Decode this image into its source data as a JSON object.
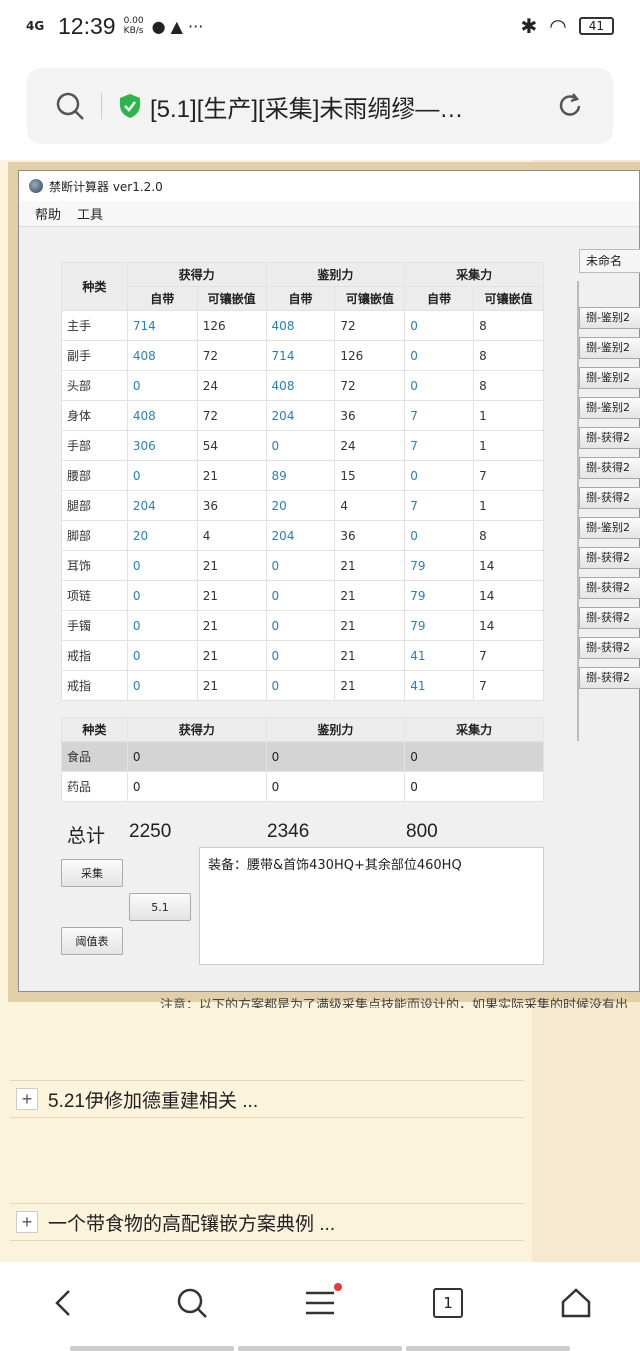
{
  "status": {
    "network": "4G",
    "time": "12:39",
    "speed_top": "0.00",
    "speed_bottom": "KB/s",
    "more": "···",
    "battery": "41"
  },
  "browser": {
    "title": "[5.1][生产][采集]未雨绸缪—…",
    "tab_count": "1"
  },
  "app": {
    "title": "禁断计算器 ver1.2.0",
    "menu": [
      "帮助",
      "工具"
    ],
    "table": {
      "col_type": "种类",
      "groups": [
        "获得力",
        "鉴别力",
        "采集力"
      ],
      "sub": [
        "自带",
        "可镶嵌值"
      ],
      "rows": [
        {
          "name": "主手",
          "v": [
            "714",
            "126",
            "408",
            "72",
            "0",
            "8"
          ]
        },
        {
          "name": "副手",
          "v": [
            "408",
            "72",
            "714",
            "126",
            "0",
            "8"
          ]
        },
        {
          "name": "头部",
          "v": [
            "0",
            "24",
            "408",
            "72",
            "0",
            "8"
          ]
        },
        {
          "name": "身体",
          "v": [
            "408",
            "72",
            "204",
            "36",
            "7",
            "1"
          ]
        },
        {
          "name": "手部",
          "v": [
            "306",
            "54",
            "0",
            "24",
            "7",
            "1"
          ]
        },
        {
          "name": "腰部",
          "v": [
            "0",
            "21",
            "89",
            "15",
            "0",
            "7"
          ]
        },
        {
          "name": "腿部",
          "v": [
            "204",
            "36",
            "20",
            "4",
            "7",
            "1"
          ]
        },
        {
          "name": "脚部",
          "v": [
            "20",
            "4",
            "204",
            "36",
            "0",
            "8"
          ]
        },
        {
          "name": "耳饰",
          "v": [
            "0",
            "21",
            "0",
            "21",
            "79",
            "14"
          ]
        },
        {
          "name": "项链",
          "v": [
            "0",
            "21",
            "0",
            "21",
            "79",
            "14"
          ]
        },
        {
          "name": "手镯",
          "v": [
            "0",
            "21",
            "0",
            "21",
            "79",
            "14"
          ]
        },
        {
          "name": "戒指",
          "v": [
            "0",
            "21",
            "0",
            "21",
            "41",
            "7"
          ]
        },
        {
          "name": "戒指",
          "v": [
            "0",
            "21",
            "0",
            "21",
            "41",
            "7"
          ]
        }
      ]
    },
    "food_table": {
      "rows": [
        {
          "name": "食品",
          "v": [
            "0",
            "0",
            "0"
          ]
        },
        {
          "name": "药品",
          "v": [
            "0",
            "0",
            "0"
          ]
        }
      ]
    },
    "totals": {
      "label": "总计",
      "gain": "2250",
      "ident": "2346",
      "gather": "800"
    },
    "buttons": {
      "collect": "采集",
      "version": "5.1",
      "threshold": "阈值表"
    },
    "notes": "装备：腰带&首饰430HQ+其余部位460HQ",
    "side": {
      "unnamed": "未命名",
      "buttons": [
        "捌-鉴别2",
        "捌-鉴别2",
        "捌-鉴别2",
        "捌-鉴别2",
        "捌-获得2",
        "捌-获得2",
        "捌-获得2",
        "捌-鉴别2",
        "捌-获得2",
        "捌-获得2",
        "捌-获得2",
        "捌-获得2",
        "捌-获得2"
      ]
    }
  },
  "page": {
    "caption": "注意：以下的方案都是为了满级采集点技能而设计的，如果实际采集的时候没有出",
    "threads": [
      "5.21伊修加德重建相关 ...",
      "一个带食物的高配镶嵌方案典例 ..."
    ]
  }
}
